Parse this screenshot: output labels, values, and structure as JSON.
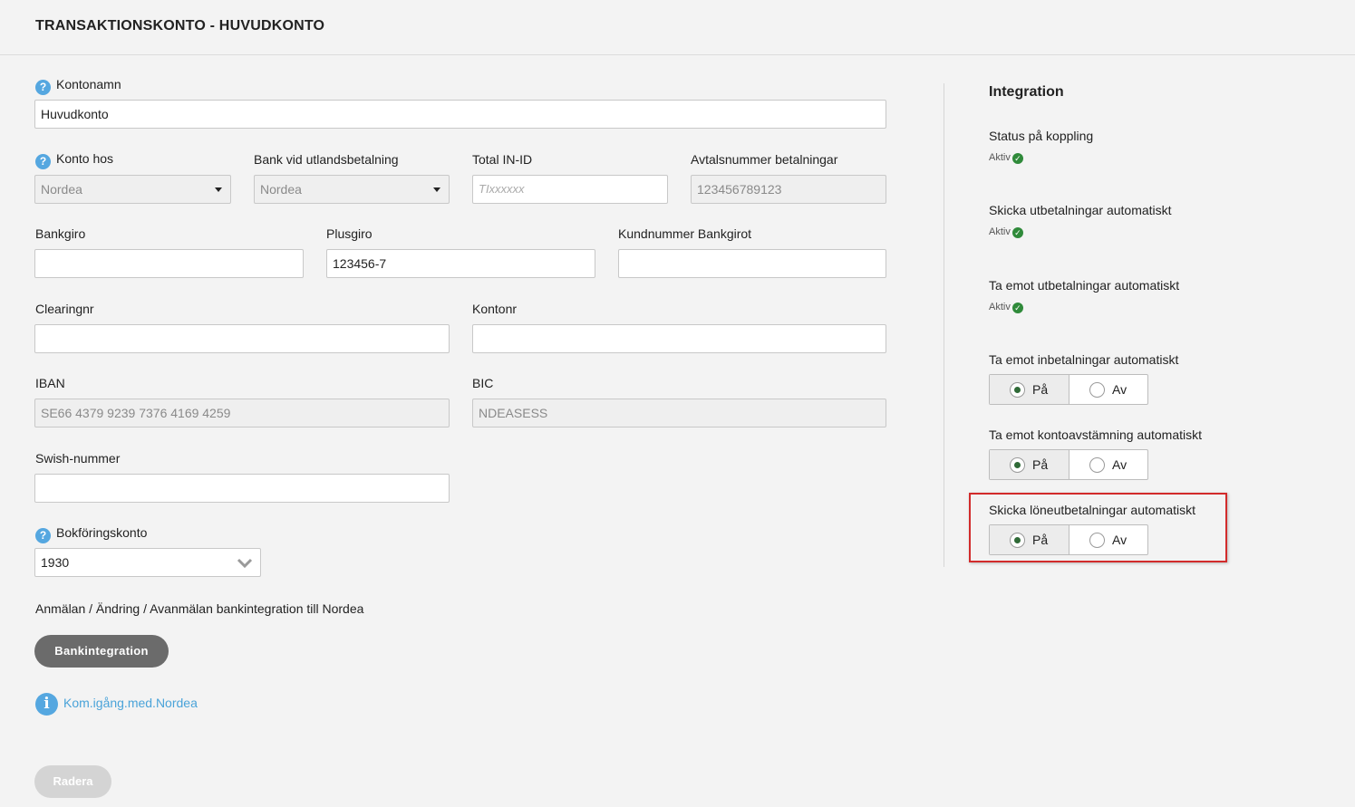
{
  "page_title": "TRANSAKTIONSKONTO - HUVUDKONTO",
  "form": {
    "kontonamn": {
      "label": "Kontonamn",
      "value": "Huvudkonto"
    },
    "konto_hos": {
      "label": "Konto hos",
      "value": "Nordea"
    },
    "bank_utland": {
      "label": "Bank vid utlandsbetalning",
      "value": "Nordea"
    },
    "total_in_id": {
      "label": "Total IN-ID",
      "placeholder": "TIxxxxxx"
    },
    "avtalsnummer": {
      "label": "Avtalsnummer betalningar",
      "value": "123456789123"
    },
    "bankgiro": {
      "label": "Bankgiro",
      "value": ""
    },
    "plusgiro": {
      "label": "Plusgiro",
      "value": "123456-7"
    },
    "kundnummer": {
      "label": "Kundnummer Bankgirot",
      "value": ""
    },
    "clearingnr": {
      "label": "Clearingnr",
      "value": ""
    },
    "kontonr": {
      "label": "Kontonr",
      "value": ""
    },
    "iban": {
      "label": "IBAN",
      "value": "SE66 4379 9239 7376 4169 4259"
    },
    "bic": {
      "label": "BIC",
      "value": "NDEASESS"
    },
    "swish": {
      "label": "Swish-nummer",
      "value": ""
    },
    "bokforingskonto": {
      "label": "Bokföringskonto",
      "value": "1930"
    },
    "help_glyph": "?"
  },
  "bankintegration": {
    "text": "Anmälan / Ändring / Avanmälan bankintegration till Nordea",
    "button": "Bankintegration",
    "link": "Kom.igång.med.Nordea",
    "info_glyph": "i"
  },
  "delete_button": "Radera",
  "integration": {
    "title": "Integration",
    "statuses": [
      {
        "label": "Status på koppling",
        "status": "Aktiv"
      },
      {
        "label": "Skicka utbetalningar automatiskt",
        "status": "Aktiv"
      },
      {
        "label": "Ta emot utbetalningar automatiskt",
        "status": "Aktiv"
      }
    ],
    "toggles": [
      {
        "label": "Ta emot inbetalningar automatiskt",
        "on": "På",
        "off": "Av",
        "selected": "På"
      },
      {
        "label": "Ta emot kontoavstämning automatiskt",
        "on": "På",
        "off": "Av",
        "selected": "På"
      },
      {
        "label": "Skicka löneutbetalningar automatiskt",
        "on": "På",
        "off": "Av",
        "selected": "På",
        "highlighted": true
      }
    ],
    "check_glyph": "✓"
  },
  "colors": {
    "accent": "#55a7e0",
    "active_green": "#2f8a3a",
    "highlight_red": "#d22b2b",
    "button_dark": "#6b6b6b"
  }
}
